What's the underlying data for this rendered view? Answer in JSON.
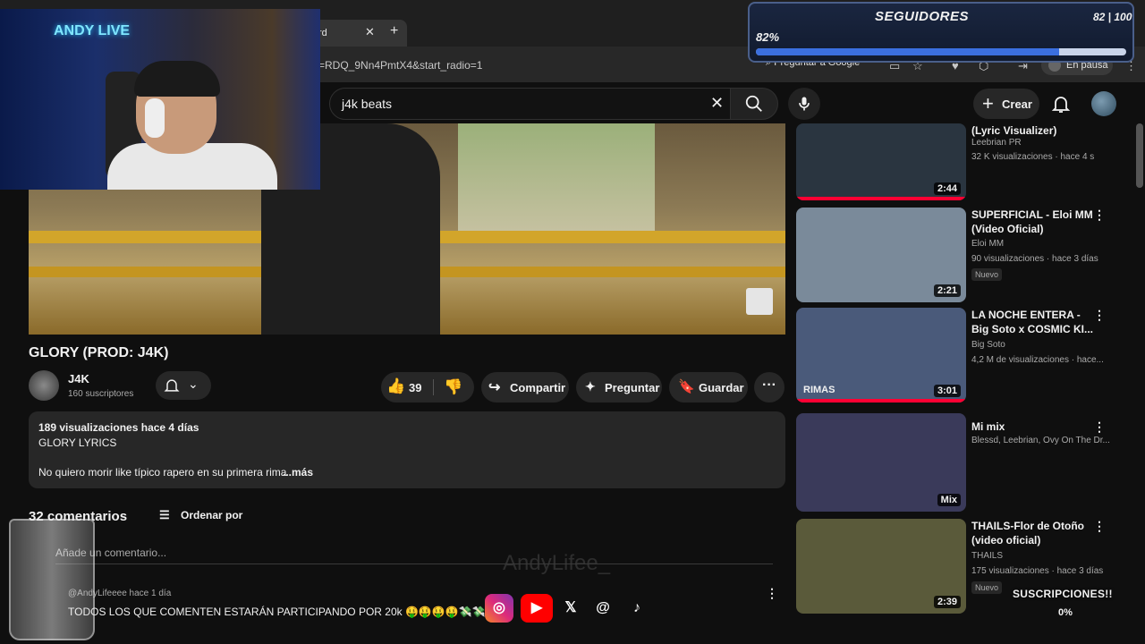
{
  "browser": {
    "tab_title": "rd",
    "url_fragment": "=RDQ_9Nn4PmtX4&start_radio=1",
    "google_pill": "Preguntar a Google",
    "profile_status": "En pausa"
  },
  "overlay": {
    "followers_title": "SEGUIDORES",
    "followers_count": "82 | 100",
    "followers_percent": "82%",
    "followers_progress": 0.82,
    "webcam_neon": "ANDY LIVE",
    "subs_title": "SUSCRIPCIONES!!",
    "subs_percent": "0%",
    "streamer_handle": "AndyLifee_"
  },
  "search": {
    "query": "j4k beats"
  },
  "header": {
    "create_label": "Crear"
  },
  "video": {
    "title": "GLORY (PROD: J4K)",
    "channel": "J4K",
    "subscribers": "160 suscriptores",
    "likes": "39",
    "share_label": "Compartir",
    "ask_label": "Preguntar",
    "save_label": "Guardar"
  },
  "description": {
    "meta": "189 visualizaciones  hace 4 días",
    "line1": "GLORY LYRICS",
    "line2": "No quiero morir like típico rapero en su primera rima",
    "more": "...más"
  },
  "comments": {
    "count": "32 comentarios",
    "sort_label": "Ordenar por",
    "input_placeholder": "Añade un comentario...",
    "first_user": "@AndyLifeeee",
    "first_time": "hace 1 día",
    "first_text": "TODOS LOS QUE COMENTEN ESTARÁN PARTICIPANDO POR 20k 🤑🤑🤑🤑💸💸💸💸"
  },
  "sidebar": [
    {
      "title": "(Lyric Visualizer)",
      "channel": "Leebrian PR",
      "views": "32 K visualizaciones · hace 4 s",
      "duration": "2:44",
      "new": "",
      "color": "#2a3540"
    },
    {
      "title": "SUPERFICIAL - Eloi MM (Video Oficial)",
      "channel": "Eloi MM",
      "views": "90 visualizaciones · hace 3 días",
      "duration": "2:21",
      "new": "Nuevo",
      "color": "#7a8a9a"
    },
    {
      "title": "LA NOCHE ENTERA - Big Soto x COSMIC KI...",
      "channel": "Big Soto",
      "views": "4,2 M de visualizaciones · hace...",
      "duration": "3:01",
      "new": "",
      "color": "#4a5a7a"
    },
    {
      "title": "Mi mix",
      "channel": "Blessd, Leebrian, Ovy On The Dr...",
      "views": "",
      "duration": "Mix",
      "new": "",
      "color": "#3a3a5a"
    },
    {
      "title": "THAILS-Flor de Otoño (video oficial)",
      "channel": "THAILS",
      "views": "175 visualizaciones · hace 3 días",
      "duration": "2:39",
      "new": "Nuevo",
      "color": "#5a5a3a"
    }
  ],
  "sidebar_overlay_label": "RIMAS"
}
